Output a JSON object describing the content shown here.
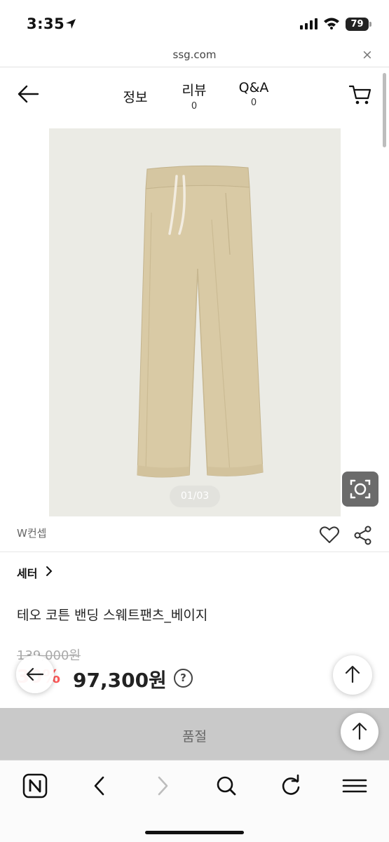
{
  "status_bar": {
    "time": "3:35",
    "battery": "79"
  },
  "url_bar": {
    "domain": "ssg.com",
    "close": "×"
  },
  "header": {
    "tabs": [
      {
        "label": "정보"
      },
      {
        "label": "리뷰",
        "count": "0"
      },
      {
        "label": "Q&A",
        "count": "0"
      }
    ]
  },
  "gallery": {
    "counter": "01/03"
  },
  "product": {
    "brand": "W컨셉",
    "category": "세터",
    "title": "테오 코튼 밴딩 스웨트팬츠_베이지",
    "original_price": "139,000원",
    "discount_rate": "30%",
    "sale_price": "97,300원",
    "help": "?"
  },
  "purchase_bar": {
    "label": "품절"
  },
  "colors": {
    "accent": "#ff5a5a",
    "soldout_bg": "#c9c9c9",
    "pants": "#d8c9a4",
    "image_bg": "#ebebe5"
  },
  "icons": [
    "location-arrow-icon",
    "signal-icon",
    "wifi-icon",
    "battery-icon",
    "back-arrow-icon",
    "cart-icon",
    "lens-search-icon",
    "heart-icon",
    "share-icon",
    "chevron-right-icon",
    "help-icon",
    "arrow-left-icon",
    "arrow-up-icon",
    "naver-home-icon",
    "browser-back-icon",
    "browser-forward-icon",
    "search-icon",
    "refresh-icon",
    "menu-icon"
  ]
}
